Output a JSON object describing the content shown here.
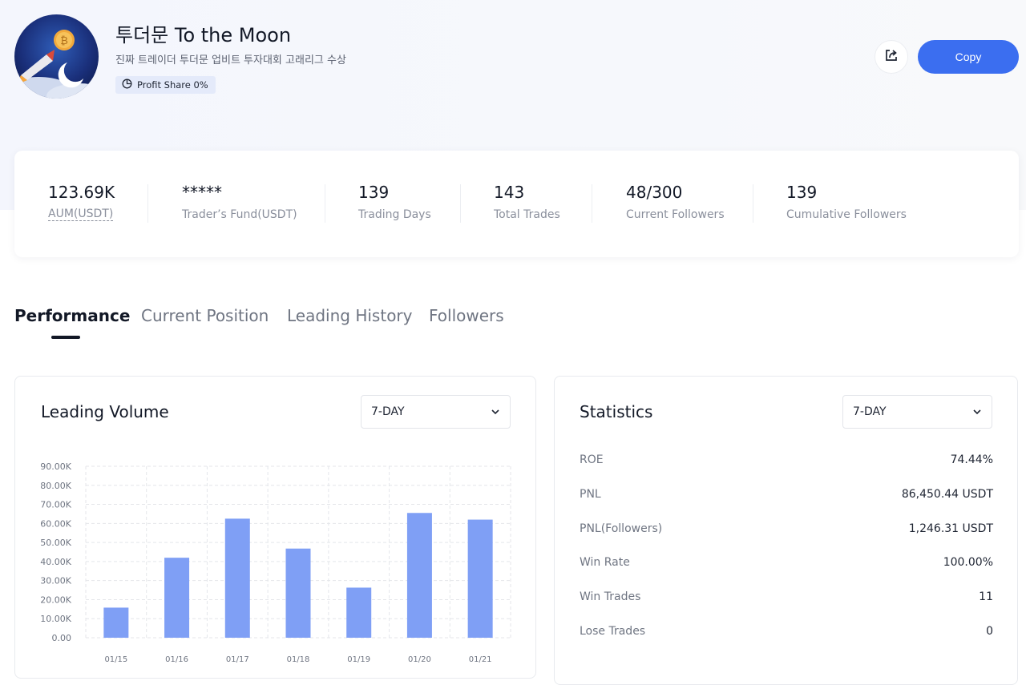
{
  "profile": {
    "name": "투더문 To the Moon",
    "bio": "진짜 트레이더 투더문 업비트 투자대회 고래리그 수상",
    "profit_share": "Profit Share 0%"
  },
  "actions": {
    "share_icon": "share-icon",
    "copy_label": "Copy"
  },
  "stats": [
    {
      "value": "123.69K",
      "label": "AUM(USDT)"
    },
    {
      "value": "*****",
      "label": "Trader’s Fund(USDT)"
    },
    {
      "value": "139",
      "label": "Trading Days"
    },
    {
      "value": "143",
      "label": "Total Trades"
    },
    {
      "value": "48/300",
      "label": "Current Followers"
    },
    {
      "value": "139",
      "label": "Cumulative Followers"
    }
  ],
  "tabs": [
    {
      "label": "Performance",
      "active": true
    },
    {
      "label": "Current Position",
      "active": false
    },
    {
      "label": "Leading History",
      "active": false
    },
    {
      "label": "Followers",
      "active": false
    }
  ],
  "leading_volume": {
    "title": "Leading Volume",
    "range": "7-DAY"
  },
  "statistics": {
    "title": "Statistics",
    "range": "7-DAY",
    "rows": [
      {
        "label": "ROE",
        "value": "74.44%"
      },
      {
        "label": "PNL",
        "value": "86,450.44 USDT"
      },
      {
        "label": "PNL(Followers)",
        "value": "1,246.31 USDT"
      },
      {
        "label": "Win Rate",
        "value": "100.00%"
      },
      {
        "label": "Win Trades",
        "value": "11"
      },
      {
        "label": "Lose Trades",
        "value": "0"
      }
    ]
  },
  "colors": {
    "accent": "#3b6ef0",
    "bar": "#7f9ff5"
  },
  "chart_data": {
    "type": "bar",
    "categories": [
      "01/15",
      "01/16",
      "01/17",
      "01/18",
      "01/19",
      "01/20",
      "01/21"
    ],
    "values": [
      15800,
      42000,
      62500,
      46800,
      26300,
      65500,
      62000
    ],
    "yticks": [
      "0.00",
      "10.00K",
      "20.00K",
      "30.00K",
      "40.00K",
      "50.00K",
      "60.00K",
      "70.00K",
      "80.00K",
      "90.00K"
    ],
    "ylim": [
      0,
      90000
    ],
    "grid": true
  }
}
